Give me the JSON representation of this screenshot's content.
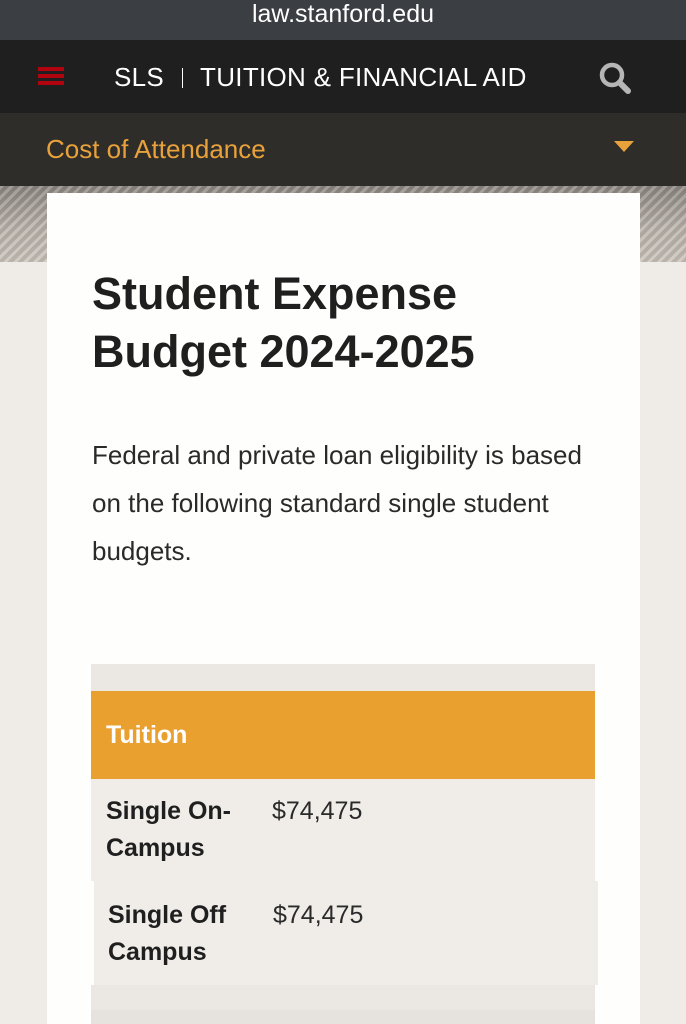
{
  "browser": {
    "url": "law.stanford.edu"
  },
  "header": {
    "brand": "SLS",
    "section_title": "TUITION & FINANCIAL AID",
    "menu_icon": "hamburger-menu-icon",
    "search_icon": "search-icon"
  },
  "section_nav": {
    "current": "Cost of Attendance",
    "caret_icon": "caret-down-icon"
  },
  "content": {
    "heading": "Student Expense Budget 2024-2025",
    "intro": "Federal and private loan eligibility is based on the following standard single student budgets."
  },
  "budget_table": {
    "header": "Tuition",
    "rows": [
      {
        "label": "Single On-Campus",
        "value": "$74,475"
      },
      {
        "label": "Single Off Campus",
        "value": "$74,475"
      }
    ]
  },
  "colors": {
    "accent_orange": "#e9a02f",
    "menu_red": "#b1040e",
    "header_dark": "#1f1f20",
    "section_bar": "#2e2d29"
  }
}
